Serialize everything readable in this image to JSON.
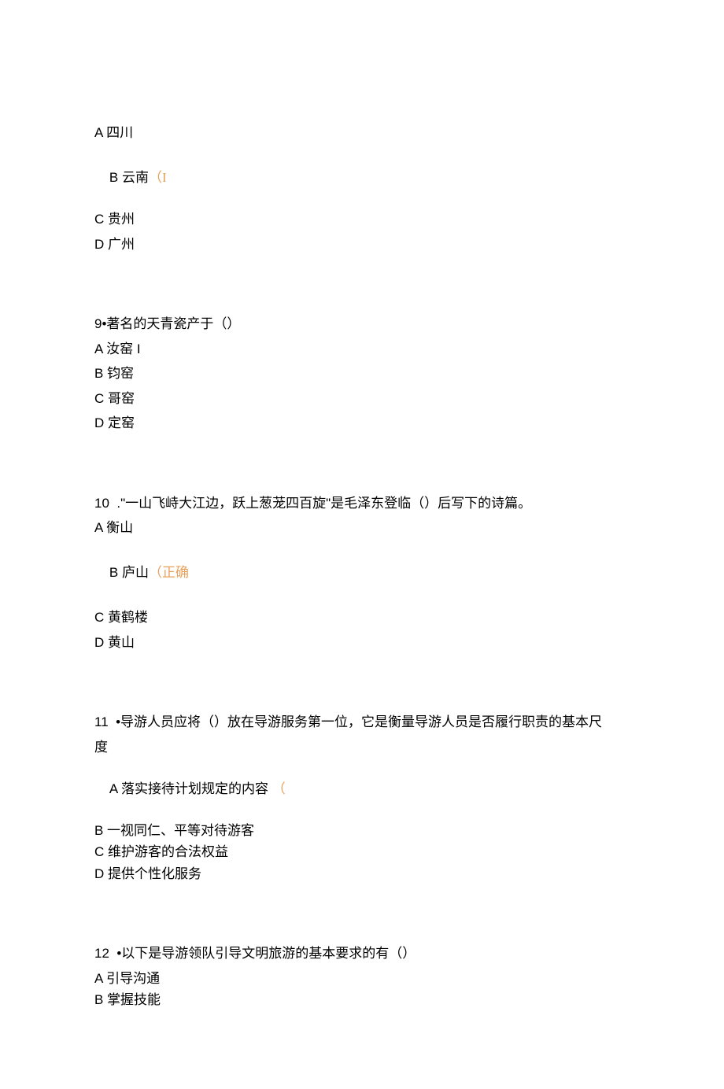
{
  "q8": {
    "a": "A 四川",
    "b_text": "B 云南",
    "b_mark": "（I",
    "c": "C 贵州",
    "d": "D 广州"
  },
  "q9": {
    "prompt": "9•著名的天青瓷产于（）",
    "a": "A 汝窑 I",
    "b": "B 钧窑",
    "c": "C 哥窑",
    "d": "D 定窑"
  },
  "q10": {
    "prompt": "10  .\"一山飞峙大江边，跃上葱茏四百旋\"是毛泽东登临（）后写下的诗篇。",
    "a": "A 衡山",
    "b_text": "B 庐山",
    "b_mark": "（正确",
    "c": "C 黄鹤楼",
    "d": "D 黄山"
  },
  "q11": {
    "prompt_l1": "11  •导游人员应将（）放在导游服务第一位，它是衡量导游人员是否履行职责的基本尺",
    "prompt_l2": "度",
    "a_text": "A 落实接待计划规定的内容",
    "a_mark": "（",
    "b": "B 一视同仁、平等对待游客",
    "c": "C 维护游客的合法权益",
    "d": "D 提供个性化服务"
  },
  "q12": {
    "prompt": "12  •以下是导游领队引导文明旅游的基本要求的有（）",
    "a": "A 引导沟通",
    "b": "B 掌握技能"
  }
}
